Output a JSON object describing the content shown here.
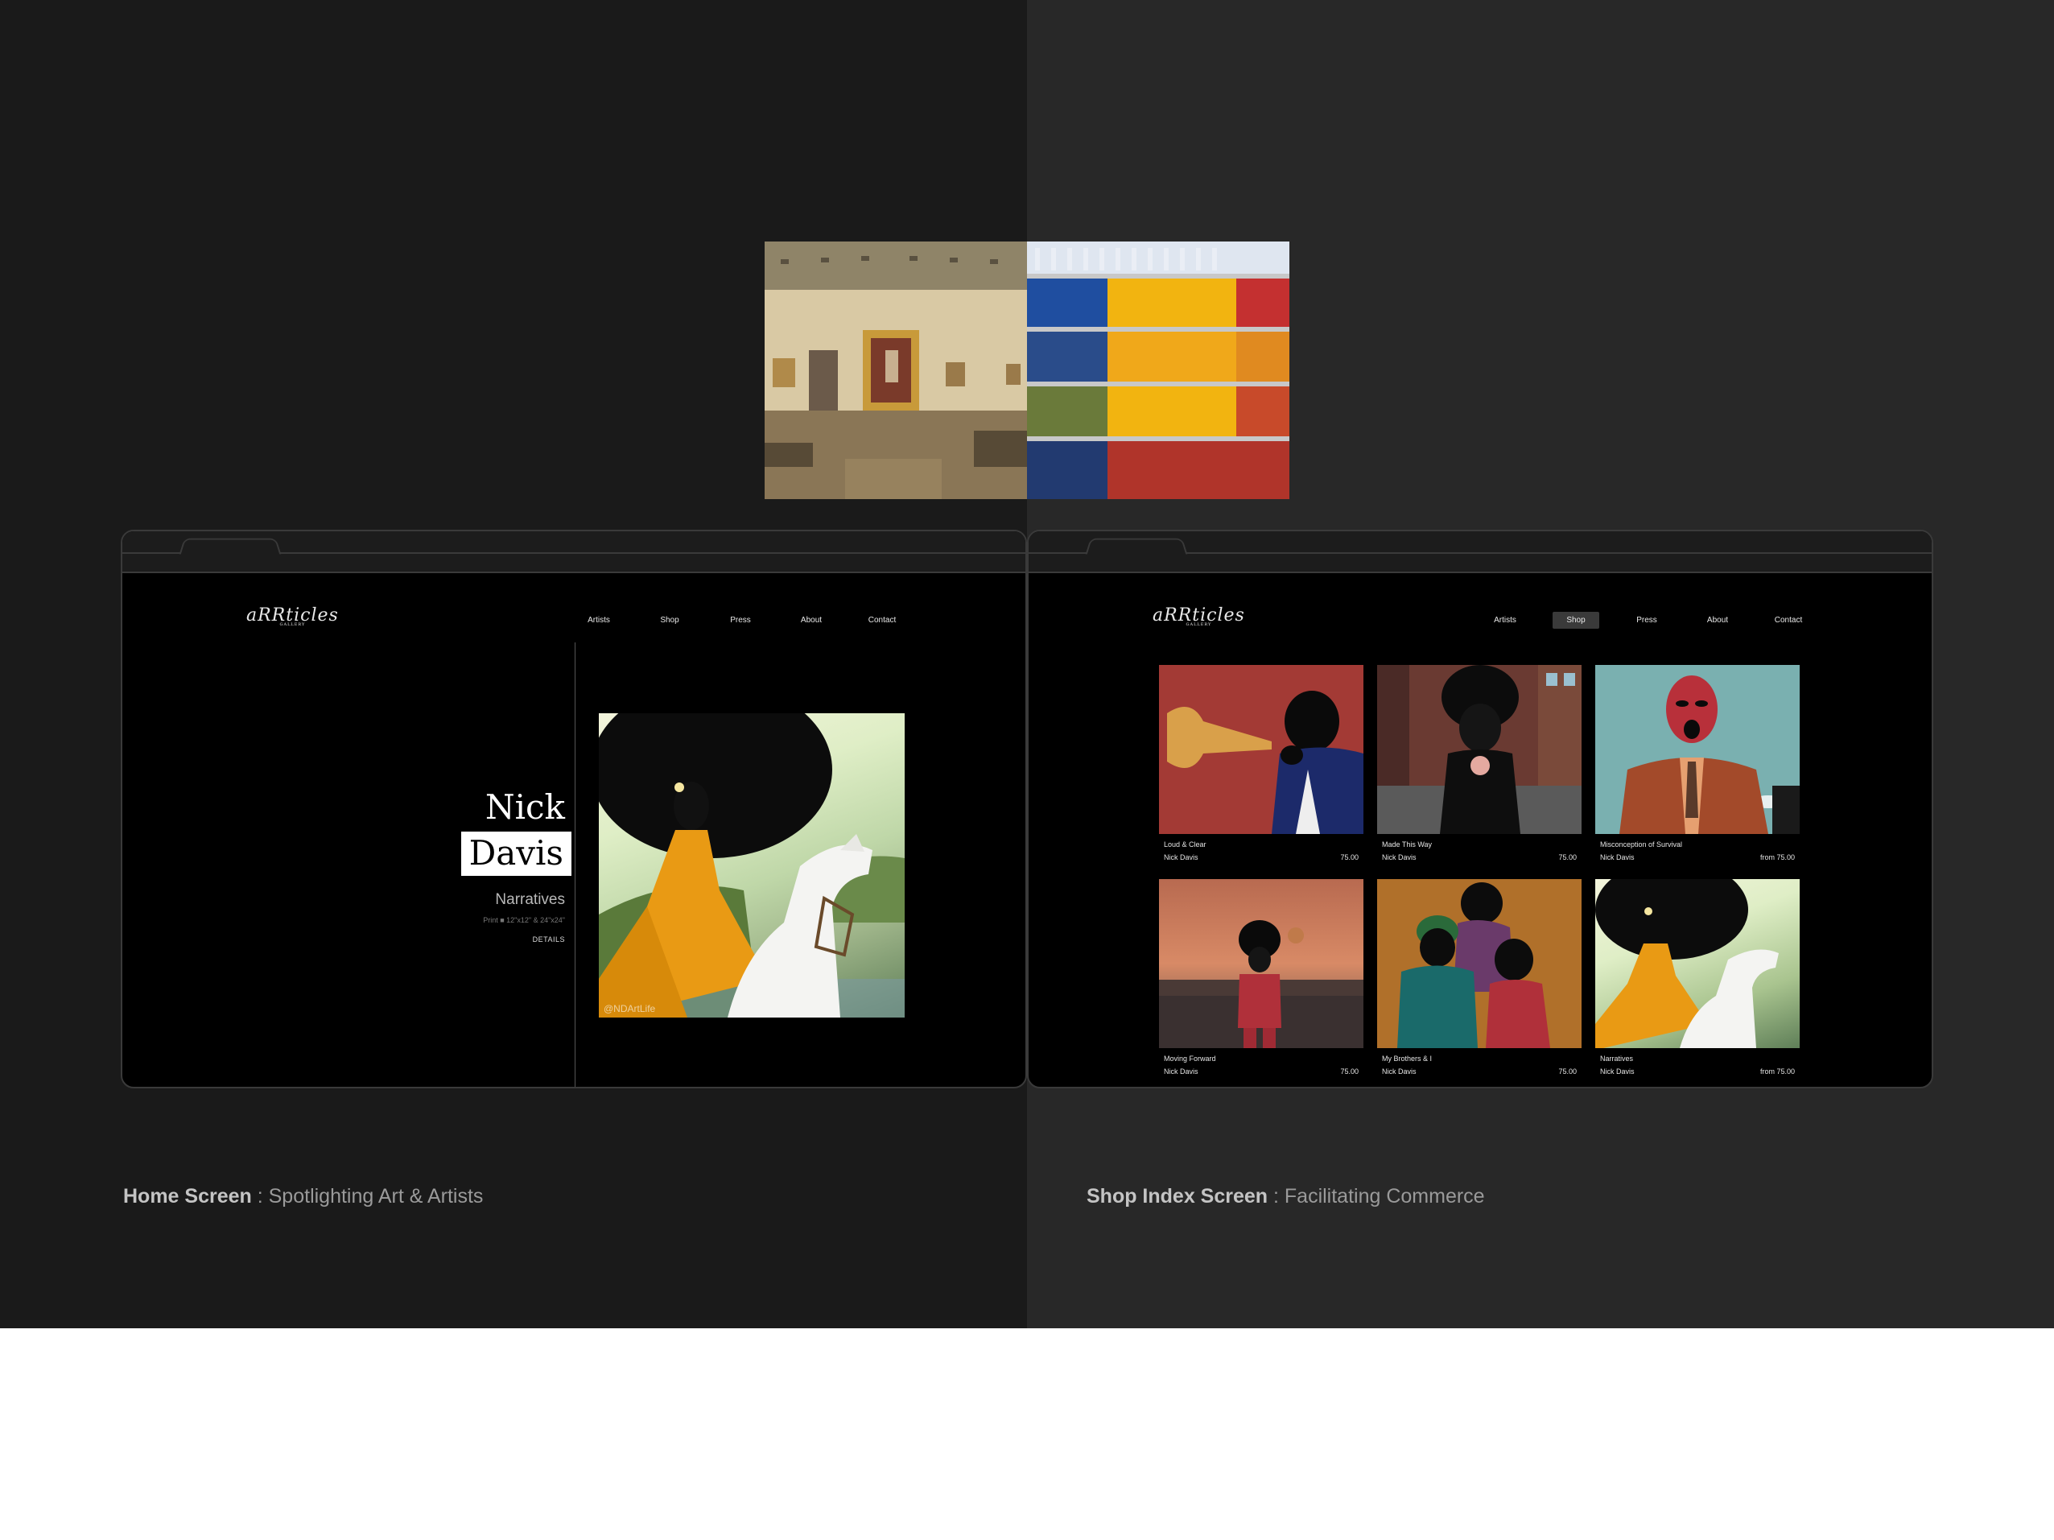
{
  "captions": {
    "home_strong": "Home Screen",
    "home_rest": " : Spotlighting Art & Artists",
    "shop_strong": "Shop Index Screen",
    "shop_rest": " : Facilitating Commerce"
  },
  "logo": {
    "text": "aRRticles",
    "sub": "GALLERY"
  },
  "nav": {
    "artists": "Artists",
    "shop": "Shop",
    "press": "Press",
    "about": "About",
    "contact": "Contact"
  },
  "home": {
    "first_name": "Nick",
    "last_name": "Davis",
    "work_title": "Narratives",
    "work_meta": "Print ■ 12\"x12\" & 24\"x24\"",
    "details_label": "DETAILS",
    "watermark": "@NDArtLife"
  },
  "shop": {
    "products": [
      {
        "title": "Loud & Clear",
        "artist": "Nick Davis",
        "price": "75.00"
      },
      {
        "title": "Made This Way",
        "artist": "Nick Davis",
        "price": "75.00"
      },
      {
        "title": "Misconception of Survival",
        "artist": "Nick Davis",
        "price": "from 75.00"
      },
      {
        "title": "Moving Forward",
        "artist": "Nick Davis",
        "price": "75.00"
      },
      {
        "title": "My Brothers & I",
        "artist": "Nick Davis",
        "price": "75.00"
      },
      {
        "title": "Narratives",
        "artist": "Nick Davis",
        "price": "from 75.00"
      }
    ]
  },
  "colors": {
    "left_background": "#1a1a1a",
    "right_background": "#282828",
    "page_black": "#000000",
    "orange": "#e99a14",
    "accent_red": "#a33a35"
  }
}
